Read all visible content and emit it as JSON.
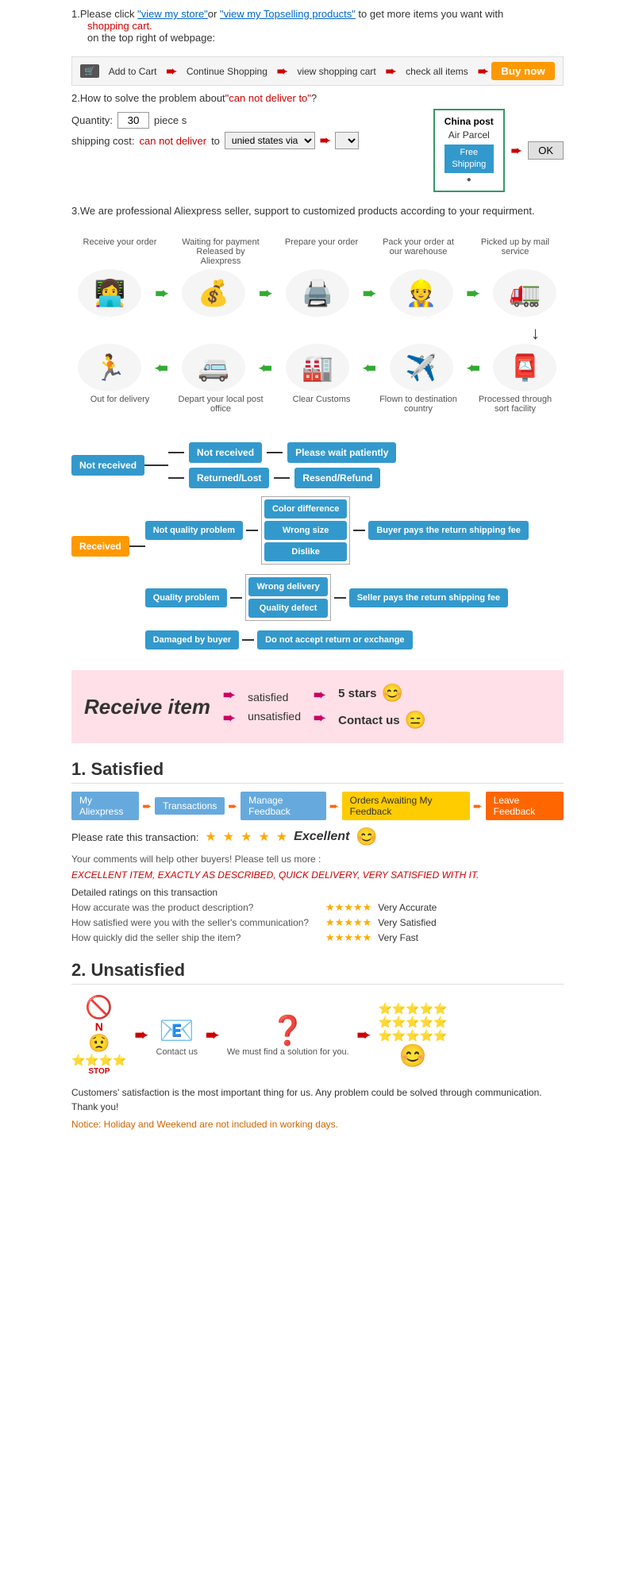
{
  "step1": {
    "text1": "1.Please click ",
    "link1": "\"view my store\"",
    "text2": "or ",
    "link2": "\"view my Topselling products\"",
    "text3": " to get more items you want with",
    "shopping_cart": "shopping cart.",
    "text4": "on the top right of webpage:"
  },
  "cart_bar": {
    "icon": "🛒",
    "steps": [
      "Add to Cart",
      "Continue Shopping",
      "view shopping cart",
      "check all items",
      "Buy now"
    ]
  },
  "step2": {
    "title": "2.How to solve the problem about",
    "highlight": "\"can not deliver to\"",
    "text": "?",
    "quantity_label": "Quantity:",
    "quantity_value": "30",
    "pieces": "piece s",
    "shipping_label": "shipping cost:",
    "cannot": "can not deliver",
    "to": " to ",
    "via_label": "unied states via"
  },
  "china_post": {
    "title": "China post",
    "subtitle": "Air Parcel",
    "free": "Free",
    "shipping": "Shipping",
    "ok": "OK"
  },
  "step3": {
    "text": "3.We are professional Aliexpress seller, support to customized products according to your requirment."
  },
  "process": {
    "row1": [
      {
        "label": "Receive your order",
        "icon": "💻"
      },
      {
        "label": "Waiting for payment Released by Aliexpress",
        "icon": "💰"
      },
      {
        "label": "Prepare your order",
        "icon": "📦"
      },
      {
        "label": "Pack your order at our warehouse",
        "icon": "👷"
      },
      {
        "label": "Picked up by mail service",
        "icon": "🚛"
      }
    ],
    "row2": [
      {
        "label": "Out for delivery",
        "icon": "🏃"
      },
      {
        "label": "Depart your local post office",
        "icon": "🚐"
      },
      {
        "label": "Clear Customs",
        "icon": "🏭"
      },
      {
        "label": "Flown to destination country",
        "icon": "✈️"
      },
      {
        "label": "Processed through sort facility",
        "icon": "📮"
      }
    ]
  },
  "not_received": {
    "main": "Not received",
    "branches": [
      {
        "label": "Not received",
        "result": "Please wait patiently"
      },
      {
        "label": "Returned/Lost",
        "result": "Resend/Refund"
      }
    ]
  },
  "received": {
    "main": "Received",
    "branches": [
      {
        "label": "Not quality problem",
        "sub": [
          "Color difference",
          "Wrong size",
          "Dislike"
        ],
        "result": "Buyer pays the return shipping fee"
      },
      {
        "label": "Quality problem",
        "sub": [
          "Wrong delivery",
          "Quality defect"
        ],
        "result": "Seller pays the return shipping fee"
      },
      {
        "label": "Damaged by buyer",
        "sub": [],
        "result": "Do not accept return or exchange"
      }
    ]
  },
  "receive_section": {
    "title": "Receive item",
    "rows": [
      {
        "label": "satisfied",
        "result": "5 stars",
        "emoji": "😊"
      },
      {
        "label": "unsatisfied",
        "result": "Contact us",
        "emoji": "😑"
      }
    ]
  },
  "satisfied": {
    "title": "1. Satisfied",
    "feedback_steps": [
      "My Aliexpress",
      "Transactions",
      "Manage Feedback",
      "Orders Awaiting My Feedback",
      "Leave Feedback"
    ],
    "rate_text": "Please rate this transaction:",
    "excellent": "Excellent",
    "comment_text": "Your comments will help other buyers! Please tell us more :",
    "review": "EXCELLENT ITEM, EXACTLY AS DESCRIBED, QUICK DELIVERY, VERY SATISFIED WITH IT.",
    "ratings_title": "Detailed ratings on this transaction",
    "ratings": [
      {
        "label": "How accurate was the product description?",
        "stars": 5,
        "value": "Very Accurate"
      },
      {
        "label": "How satisfied were you with the seller's communication?",
        "stars": 5,
        "value": "Very Satisfied"
      },
      {
        "label": "How quickly did the seller ship the item?",
        "stars": 5,
        "value": "Very Fast"
      }
    ]
  },
  "unsatisfied": {
    "title": "2. Unsatisfied",
    "steps": [
      {
        "icon": "🚫\nN\n😟\n⭐⭐⭐⭐\n🛑",
        "label": ""
      },
      {
        "icon": "📧",
        "label": "Contact us"
      },
      {
        "icon": "❓",
        "label": "We must find a solution for you."
      },
      {
        "icon": "⭐⭐⭐⭐⭐\n⭐⭐⭐⭐⭐\n⭐⭐⭐⭐⭐\n😊",
        "label": ""
      }
    ],
    "footer": "Customers' satisfaction is the most important thing for us. Any problem could be solved through communication. Thank you!",
    "notice": "Notice: Holiday and Weekend are not included in working days."
  }
}
